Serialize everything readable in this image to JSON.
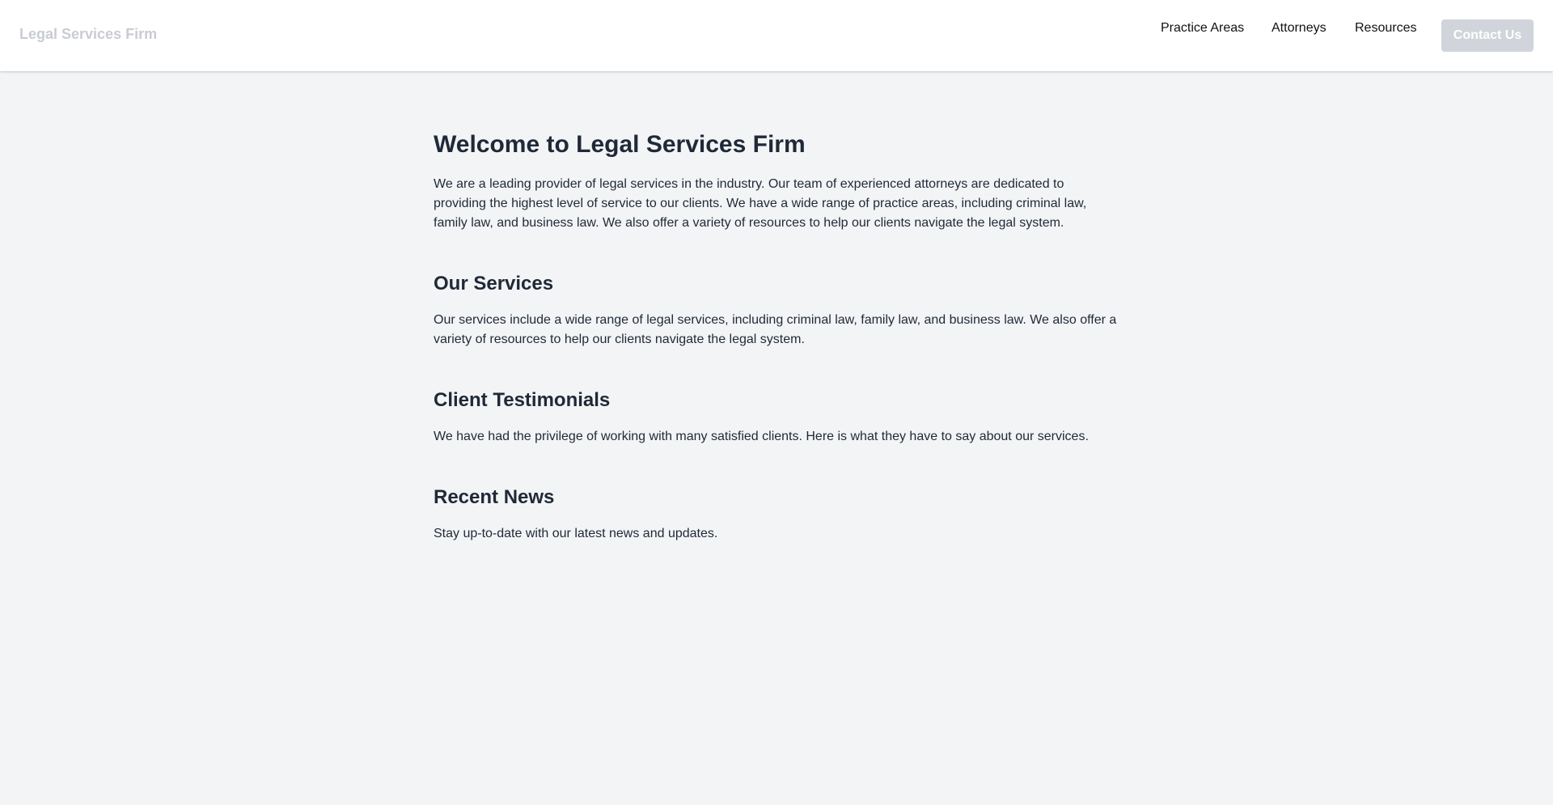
{
  "header": {
    "brand": "Legal Services Firm",
    "nav": [
      {
        "label": "Practice Areas"
      },
      {
        "label": "Attorneys"
      },
      {
        "label": "Resources"
      }
    ],
    "contact_label": "Contact Us"
  },
  "sections": [
    {
      "title": "Welcome to Legal Services Firm",
      "text": "We are a leading provider of legal services in the industry. Our team of experienced attorneys are dedicated to providing the highest level of service to our clients. We have a wide range of practice areas, including criminal law, family law, and business law. We also offer a variety of resources to help our clients navigate the legal system."
    },
    {
      "title": "Our Services",
      "text": "Our services include a wide range of legal services, including criminal law, family law, and business law. We also offer a variety of resources to help our clients navigate the legal system."
    },
    {
      "title": "Client Testimonials",
      "text": "We have had the privilege of working with many satisfied clients. Here is what they have to say about our services."
    },
    {
      "title": "Recent News",
      "text": "Stay up-to-date with our latest news and updates."
    }
  ],
  "colors": {
    "page_bg": "#f3f4f6",
    "header_bg": "#ffffff",
    "brand_text": "#c9ccd2",
    "button_bg": "#d1d5db",
    "heading_text": "#1f2937"
  }
}
